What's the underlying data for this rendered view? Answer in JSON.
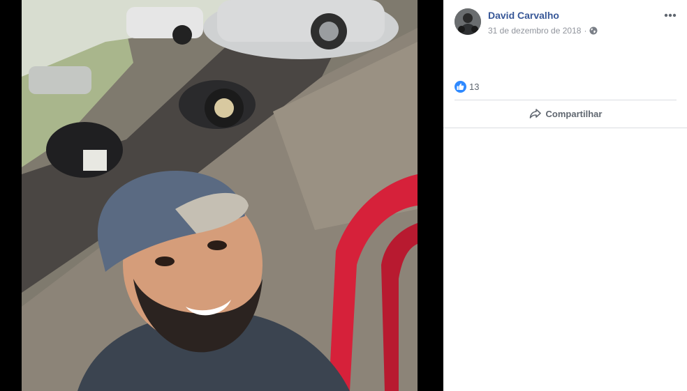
{
  "post": {
    "author_name": "David Carvalho",
    "date": "31 de dezembro de 2018",
    "separator": "·",
    "privacy_icon": "globe-icon",
    "more_icon": "more-options-icon"
  },
  "reactions": {
    "icon": "like-icon",
    "count": "13"
  },
  "actions": {
    "share_label": "Compartilhar",
    "share_icon": "share-arrow-icon"
  },
  "colors": {
    "author_link": "#385898",
    "secondary_text": "#90949c",
    "like_blue": "#2e89ff",
    "photo_background": "#000000"
  }
}
